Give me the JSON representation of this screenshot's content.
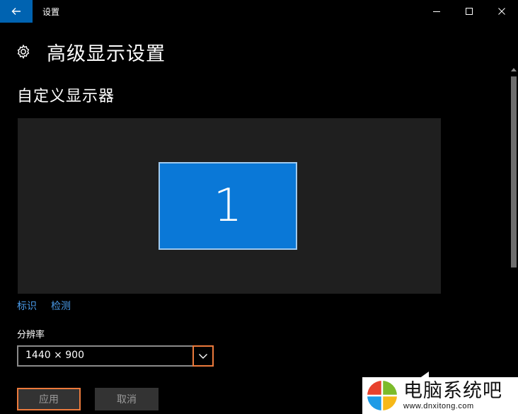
{
  "window": {
    "title": "设置"
  },
  "page": {
    "title": "高级显示设置",
    "section_title": "自定义显示器"
  },
  "preview": {
    "monitor_number": "1"
  },
  "links": {
    "identify": "标识",
    "detect": "检测"
  },
  "resolution": {
    "label": "分辨率",
    "value": "1440 × 900"
  },
  "buttons": {
    "apply": "应用",
    "cancel": "取消"
  },
  "watermark": {
    "title": "电脑系统吧",
    "url": "www.dnxitong.com"
  },
  "colors": {
    "accent": "#0063b1",
    "monitor": "#0a78d7",
    "link": "#4a9bea",
    "highlight": "#ec7a3c"
  }
}
